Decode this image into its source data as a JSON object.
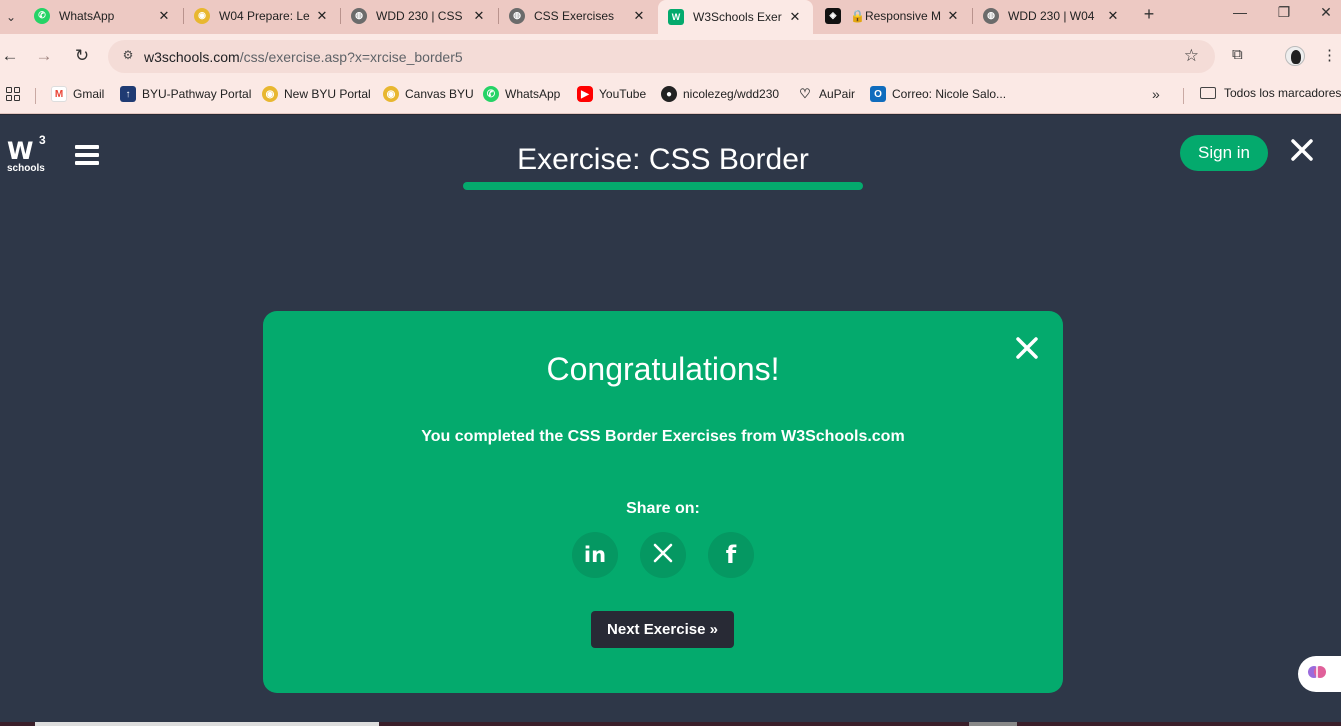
{
  "browser": {
    "tabs": [
      {
        "title": "WhatsApp",
        "icon": "whatsapp-icon",
        "color": "#25D366"
      },
      {
        "title": "W04 Prepare: Le",
        "icon": "canvas-icon",
        "color": "#E8B730"
      },
      {
        "title": "WDD 230 | CSS",
        "icon": "globe-icon",
        "color": "#6b6b6b"
      },
      {
        "title": "CSS Exercises",
        "icon": "globe-icon",
        "color": "#6b6b6b"
      },
      {
        "title": "W3Schools Exer",
        "icon": "w3schools-icon",
        "color": "#04AA6D"
      },
      {
        "title": "🔒Responsive M",
        "icon": "codepen-icon",
        "color": "#111111"
      },
      {
        "title": "WDD 230 | W04",
        "icon": "globe-icon",
        "color": "#6b6b6b"
      }
    ],
    "active_tab": 4,
    "url_host": "w3schools.com",
    "url_rest": "/css/exercise.asp?x=xrcise_border5",
    "bookmarks": [
      {
        "label": "Gmail",
        "icon": "gmail-icon",
        "color": "#EA4335"
      },
      {
        "label": "BYU-Pathway Portal",
        "icon": "pathway-icon",
        "color": "#1f3b73"
      },
      {
        "label": "New BYU Portal",
        "icon": "canvas-icon",
        "color": "#E8B730"
      },
      {
        "label": "Canvas BYU",
        "icon": "canvas-icon",
        "color": "#E8B730"
      },
      {
        "label": "WhatsApp",
        "icon": "whatsapp-icon",
        "color": "#25D366"
      },
      {
        "label": "YouTube",
        "icon": "youtube-icon",
        "color": "#FF0000"
      },
      {
        "label": "nicolezeg/wdd230",
        "icon": "github-icon",
        "color": "#222222"
      },
      {
        "label": "AuPair",
        "icon": "heart-icon",
        "color": "#444444"
      },
      {
        "label": "Correo: Nicole Salo...",
        "icon": "outlook-icon",
        "color": "#0F6CBD"
      }
    ],
    "all_bookmarks_label": "Todos los marcadores"
  },
  "page": {
    "logo_mark": "W",
    "logo_superscript": "3",
    "logo_text": "schools",
    "title": "Exercise: CSS Border",
    "signin_label": "Sign in"
  },
  "modal": {
    "heading": "Congratulations!",
    "message": "You completed the CSS Border Exercises from W3Schools.com",
    "share_label": "Share on:",
    "social": [
      {
        "name": "linkedin-icon",
        "glyph": "in"
      },
      {
        "name": "x-twitter-icon",
        "glyph": "𝕏"
      },
      {
        "name": "facebook-icon",
        "glyph": "f"
      }
    ],
    "next_label": "Next Exercise »"
  },
  "colors": {
    "accent_green": "#04AA6D",
    "page_bg": "#2E3748",
    "dark_button": "#282A35",
    "chrome_bg": "#EDC9C3"
  }
}
